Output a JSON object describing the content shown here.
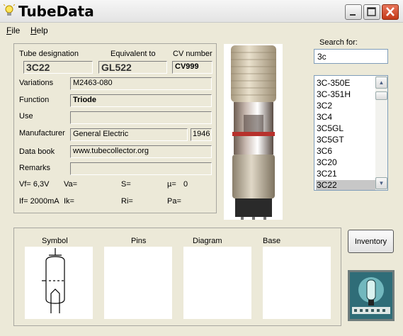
{
  "window": {
    "title": "TubeData",
    "icon": "lightbulb-icon"
  },
  "menu": [
    {
      "underline": "F",
      "rest": "ile"
    },
    {
      "underline": "H",
      "rest": "elp"
    }
  ],
  "details": {
    "designation_label": "Tube designation",
    "designation_value": "3C22",
    "equivalent_label": "Equivalent to",
    "equivalent_value": "GL522",
    "cv_label": "CV number",
    "cv_value": "CV999",
    "variations_label": "Variations",
    "variations_value": "M2463-080",
    "function_label": "Function",
    "function_value": "Triode",
    "use_label": "Use",
    "use_value": "",
    "manufacturer_label": "Manufacturer",
    "manufacturer_value": "General Electric",
    "year_value": "1946",
    "databook_label": "Data book",
    "databook_value": "www.tubecollector.org",
    "remarks_label": "Remarks",
    "remarks_value": ""
  },
  "params": {
    "vf": "Vf= 6,3V",
    "va": "Va=",
    "s": "S=",
    "mu": "µ=",
    "mu_value": "0",
    "if": "If= 2000mA",
    "ik": "Ik=",
    "ri": "Ri=",
    "pa": "Pa="
  },
  "search": {
    "label": "Search for:",
    "value": "3c"
  },
  "tube_list": {
    "items": [
      "3C-350E",
      "3C-351H",
      "3C2",
      "3C4",
      "3C5GL",
      "3C5GT",
      "3C6",
      "3C20",
      "3C21",
      "3C22"
    ],
    "selected": "3C22"
  },
  "panels": {
    "symbol": "Symbol",
    "pins": "Pins",
    "diagram": "Diagram",
    "base": "Base"
  },
  "inventory_button": "Inventory",
  "icons": {
    "minimize": "minimize-icon",
    "maximize": "maximize-icon",
    "close": "close-icon",
    "scroll_up": "chevron-up-icon",
    "scroll_down": "chevron-down-icon"
  },
  "colors": {
    "face": "#ece9d8",
    "close_button": "#c94a2a",
    "selection": "#c7c7c7",
    "input_border": "#7f9db9"
  }
}
